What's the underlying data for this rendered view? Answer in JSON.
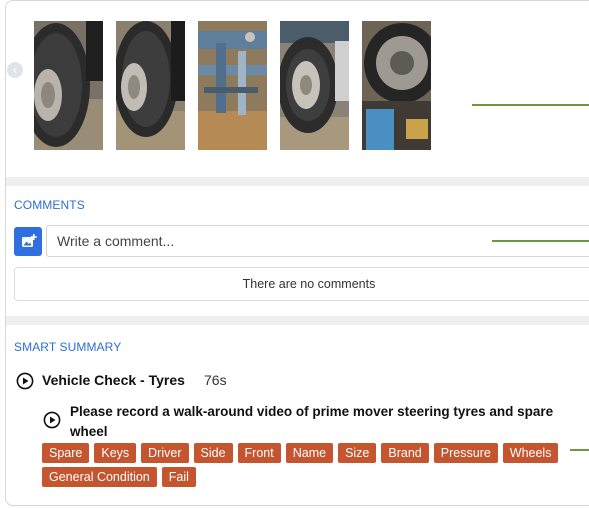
{
  "gallery": {
    "prev_arrow_icon": "chevron-left-icon",
    "photos": [
      {
        "subject": "tyre-closeup"
      },
      {
        "subject": "tyre-closeup"
      },
      {
        "subject": "chassis-underside"
      },
      {
        "subject": "steering-tyre"
      },
      {
        "subject": "spare-wheel"
      }
    ]
  },
  "comments": {
    "title": "COMMENTS",
    "add_media_icon": "add-photo-icon",
    "input_placeholder": "Write a comment...",
    "empty_text": "There are no comments"
  },
  "smart_summary": {
    "title": "SMART SUMMARY",
    "check_title": "Vehicle Check - Tyres",
    "check_duration": "76s",
    "question": "Please record a walk-around video of prime mover steering tyres and spare wheel",
    "tags": [
      "Spare",
      "Keys",
      "Driver",
      "Side",
      "Front",
      "Name",
      "Size",
      "Brand",
      "Pressure",
      "Wheels",
      "General Condition",
      "Fail"
    ]
  },
  "colors": {
    "accent_blue": "#2b6fd6",
    "tag_orange": "#c4552f",
    "callout_green": "#6b9a3c"
  }
}
